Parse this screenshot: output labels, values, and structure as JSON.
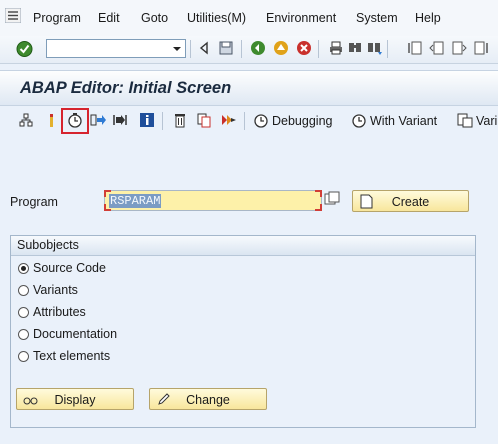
{
  "menu": {
    "items": [
      "Program",
      "Edit",
      "Goto",
      "Utilities(M)",
      "Environment",
      "System",
      "Help"
    ]
  },
  "standard_toolbar": {
    "command_field": {
      "value": "",
      "placeholder": ""
    },
    "icons": [
      "enter-icon",
      "back-icon",
      "save-icon",
      "green-back-icon",
      "exit-icon",
      "cancel-icon",
      "print-icon",
      "find-icon",
      "find-next-icon",
      "first-page-icon",
      "previous-page-icon",
      "next-page-icon",
      "last-page-icon"
    ]
  },
  "title": "ABAP Editor: Initial Screen",
  "application_toolbar": {
    "debugging_label": "Debugging",
    "with_variant_label": "With Variant",
    "truncated_label": "Vari",
    "highlighted_icon": "execute-icon"
  },
  "program": {
    "label": "Program",
    "value": "RSPARAM",
    "create_label": "Create"
  },
  "subobjects": {
    "title": "Subobjects",
    "options": [
      {
        "label": "Source Code",
        "checked": true
      },
      {
        "label": "Variants",
        "checked": false
      },
      {
        "label": "Attributes",
        "checked": false
      },
      {
        "label": "Documentation",
        "checked": false
      },
      {
        "label": "Text elements",
        "checked": false
      }
    ]
  },
  "buttons": {
    "display_label": "Display",
    "change_label": "Change"
  },
  "colors": {
    "background": "#eaf1fa",
    "required_field": "#fdf1a9",
    "button_face": "#f8e69c",
    "highlight_border": "#d6242e",
    "selection": "#7b9cc4"
  }
}
